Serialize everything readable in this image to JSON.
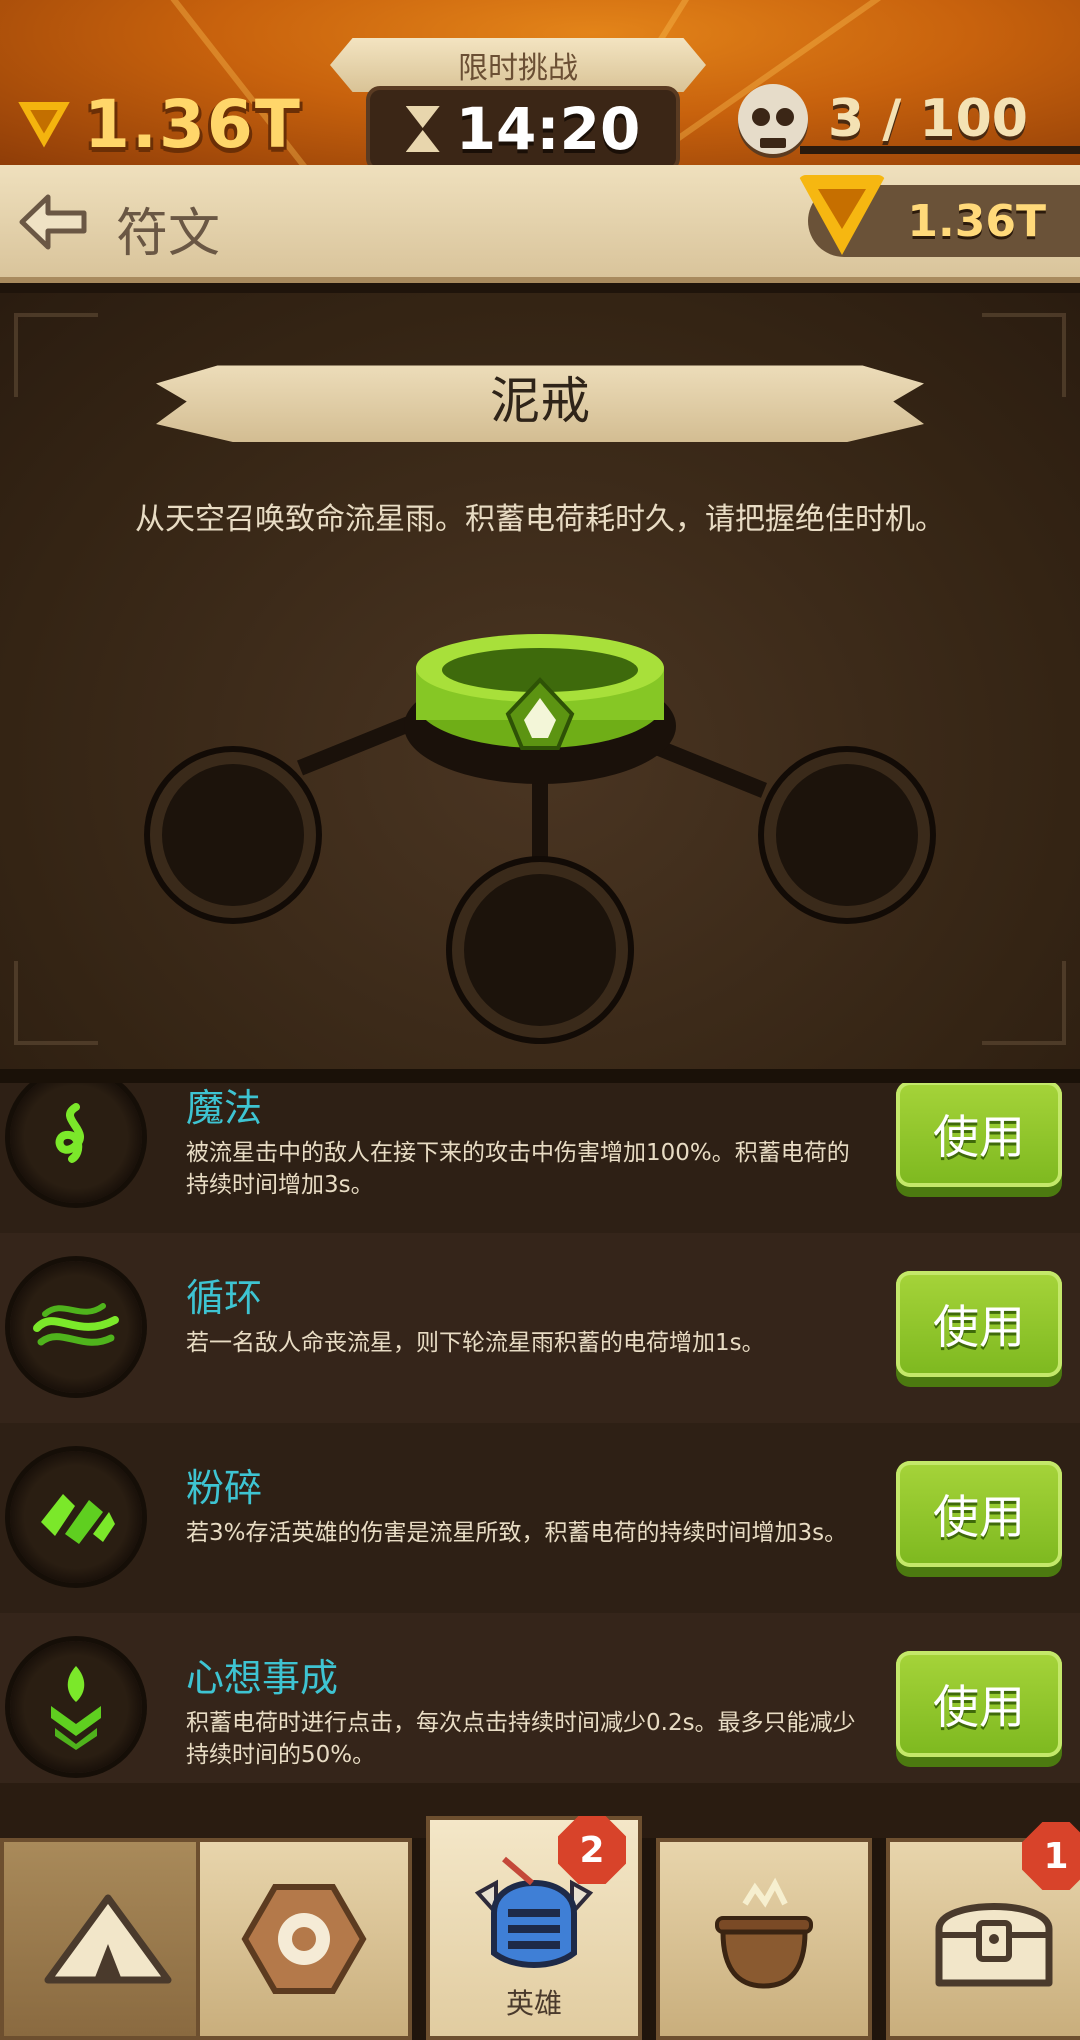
{
  "hud": {
    "currency": "1.36T",
    "challenge_label": "限时挑战",
    "timer": "14:20",
    "kills": "3 / 100"
  },
  "header": {
    "title": "符文",
    "currency": "1.36T"
  },
  "rune": {
    "name": "泥戒",
    "description": "从天空召唤致命流星雨。积蓄电荷耗时久，请把握绝佳时机。",
    "icon": "green-ring-icon"
  },
  "abilities": [
    {
      "title": "魔法",
      "description": "被流星击中的敌人在接下来的攻击中伤害增加100%。积蓄电荷的持续时间增加3s。",
      "button": "使用",
      "icon": "swirl-icon"
    },
    {
      "title": "循环",
      "description": "若一名敌人命丧流星，则下轮流星雨积蓄的电荷增加1s。",
      "button": "使用",
      "icon": "wave-icon"
    },
    {
      "title": "粉碎",
      "description": "若3%存活英雄的伤害是流星所致，积蓄电荷的持续时间增加3s。",
      "button": "使用",
      "icon": "shatter-icon"
    },
    {
      "title": "心想事成",
      "description": "积蓄电荷时进行点击，每次点击持续时间减少0.2s。最多只能减少持续时间的50%。",
      "button": "使用",
      "icon": "chevrons-icon"
    }
  ],
  "nav": {
    "items": [
      {
        "name": "camp",
        "icon": "tent-icon",
        "label": "",
        "badge": ""
      },
      {
        "name": "rune",
        "icon": "rune-stone-icon",
        "label": "",
        "badge": ""
      },
      {
        "name": "heroes",
        "icon": "knight-helmet-icon",
        "label": "英雄",
        "badge": "2"
      },
      {
        "name": "cauldron",
        "icon": "cauldron-icon",
        "label": "",
        "badge": ""
      },
      {
        "name": "chest",
        "icon": "treasure-chest-icon",
        "label": "",
        "badge": "1"
      }
    ]
  },
  "colors": {
    "accent_green": "#8cc72a",
    "title_cyan": "#3ec4d2",
    "gold": "#ffd66a",
    "badge_red": "#d8432a"
  }
}
